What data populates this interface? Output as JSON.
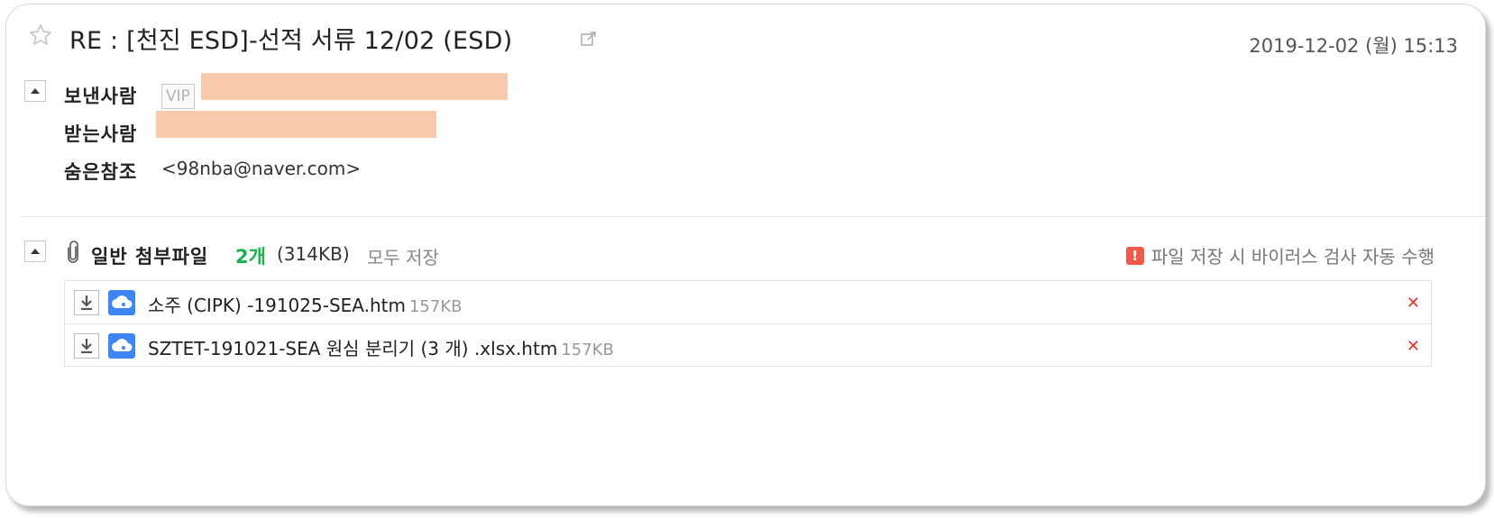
{
  "mail": {
    "subject": "RE : [천진 ESD]-선적 서류 12/02 (ESD)",
    "date": "2019-12-02 (월) 15:13"
  },
  "header_fields": {
    "from_label": "보낸사람",
    "vip_badge": "VIP",
    "to_label": "받는사람",
    "bcc_label": "숨은참조",
    "bcc_value": "<98nba@naver.com>"
  },
  "attachments": {
    "label": "일반 첨부파일",
    "count": "2개",
    "total_size": "(314KB)",
    "save_all": "모두 저장",
    "virus_notice": "파일 저장 시 바이러스 검사 자동 수행",
    "files": [
      {
        "name": "소주 (CIPK) -191025-SEA.htm",
        "size": "157KB"
      },
      {
        "name": "SZTET-191021-SEA 원심 분리기 (3 개) .xlsx.htm",
        "size": "157KB"
      }
    ]
  },
  "colors": {
    "redaction": "#f9c9ab",
    "count_green": "#19b24b",
    "cloud_blue": "#3d86f5",
    "warning_red": "#f05a4a",
    "delete_red": "#ef2e2e"
  },
  "icons": [
    "star-icon",
    "popout-icon",
    "collapse-icon",
    "paperclip-icon",
    "warning-icon",
    "download-icon",
    "cloud-save-icon",
    "delete-icon"
  ]
}
